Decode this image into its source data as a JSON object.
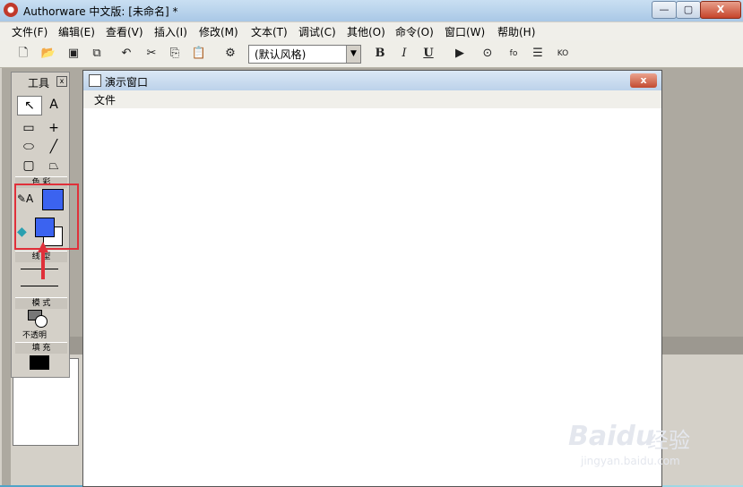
{
  "window": {
    "title": "Authorware 中文版: [未命名] *",
    "min": "—",
    "max": "▢",
    "close": "X"
  },
  "menubar": [
    "文件(F)",
    "编辑(E)",
    "查看(V)",
    "插入(I)",
    "修改(M)",
    "文本(T)",
    "调试(C)",
    "其他(O)",
    "命令(O)",
    "窗口(W)",
    "帮助(H)"
  ],
  "toolbar": {
    "style_value": "(默认风格)",
    "bold": "B",
    "italic": "I",
    "underline": "U"
  },
  "tools_palette": {
    "title": "工具",
    "color_section": "色 彩",
    "line_section": "线 型",
    "mode_section": "模 式",
    "mode_label": "不透明",
    "fill_section": "填 充",
    "colors": {
      "pen": "#3b63f0",
      "fill_fore": "#3b63f0",
      "fill_back": "#ffffff",
      "fill_pattern": "#000000"
    }
  },
  "presentation_window": {
    "title": "演示窗口",
    "menu_file": "文件",
    "close": "x"
  },
  "watermark": {
    "brand": "Bai",
    "brand2": "du",
    "cn": "经验",
    "url": "jingyan.baidu.com"
  }
}
